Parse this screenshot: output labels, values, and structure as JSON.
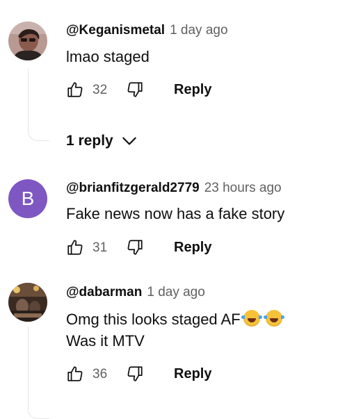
{
  "comments": [
    {
      "author": "@Keganismetal",
      "time": "1 day ago",
      "text_lines": [
        "lmao staged"
      ],
      "likes": "32",
      "reply_label": "Reply",
      "replies_toggle": "1 reply"
    },
    {
      "author": "@brianfitzgerald2779",
      "time": "23 hours ago",
      "avatar_letter": "B",
      "avatar_color": "#7e57c2",
      "text_lines": [
        "Fake news now has a fake story"
      ],
      "likes": "31",
      "reply_label": "Reply"
    },
    {
      "author": "@dabarman",
      "time": "1 day ago",
      "text_lines": [
        "Omg this looks staged AF",
        "Was it MTV"
      ],
      "emojis": [
        "face-with-tears-of-joy",
        "face-with-tears-of-joy"
      ],
      "likes": "36",
      "reply_label": "Reply"
    }
  ],
  "colors": {
    "text": "#0f0f0f",
    "secondary": "#606060",
    "thread_line": "#e5e5e5"
  }
}
